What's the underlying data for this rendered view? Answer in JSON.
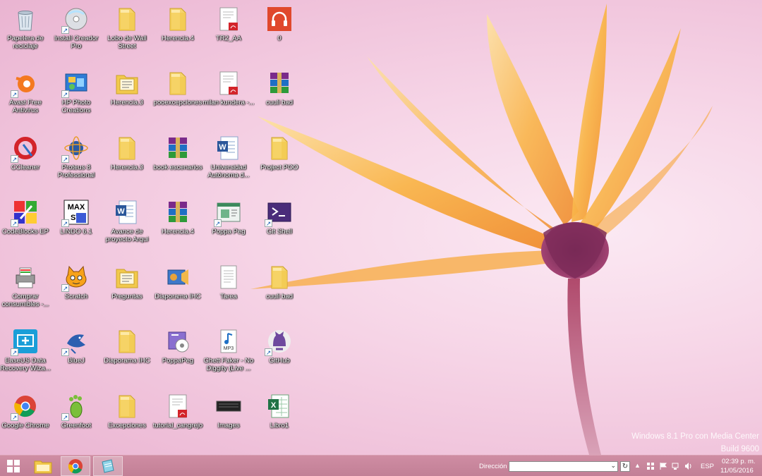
{
  "desktop": {
    "icons": [
      {
        "label": "Papelera de reciclaje",
        "icon": "recycle-bin-icon",
        "shortcut": false
      },
      {
        "label": "Avast Free Antivirus",
        "icon": "avast-icon",
        "shortcut": true
      },
      {
        "label": "CCleaner",
        "icon": "ccleaner-icon",
        "shortcut": true
      },
      {
        "label": "CodeBlocks EP",
        "icon": "codeblocks-icon",
        "shortcut": true
      },
      {
        "label": "Comprar consumibles -...",
        "icon": "printer-icon",
        "shortcut": false
      },
      {
        "label": "EaseUS Data Recovery Wiza...",
        "icon": "easeus-icon",
        "shortcut": true
      },
      {
        "label": "Google Chrome",
        "icon": "chrome-icon",
        "shortcut": true
      },
      {
        "label": "Instalí Creador Pro",
        "icon": "disc-icon",
        "shortcut": true
      },
      {
        "label": "HP Photo Creations",
        "icon": "hp-photo-icon",
        "shortcut": true
      },
      {
        "label": "Proteus 8 Professional",
        "icon": "proteus-icon",
        "shortcut": true
      },
      {
        "label": "LINDO 6.1",
        "icon": "lindo-icon",
        "shortcut": true
      },
      {
        "label": "Scratch",
        "icon": "scratch-icon",
        "shortcut": true
      },
      {
        "label": "BlueJ",
        "icon": "bluej-icon",
        "shortcut": true
      },
      {
        "label": "Greenfoot",
        "icon": "greenfoot-icon",
        "shortcut": true
      },
      {
        "label": "Lobo de Wall Street",
        "icon": "folder-icon",
        "shortcut": false
      },
      {
        "label": "Herencia.3",
        "icon": "folder-doc-icon",
        "shortcut": false
      },
      {
        "label": "Herencia.3",
        "icon": "folder-icon",
        "shortcut": false
      },
      {
        "label": "Avance de proyecto Arqui",
        "icon": "word-icon",
        "shortcut": false
      },
      {
        "label": "Preguntas",
        "icon": "folder-doc-icon",
        "shortcut": false
      },
      {
        "label": "Diaporama IHC",
        "icon": "folder-icon",
        "shortcut": false
      },
      {
        "label": "Excepciones",
        "icon": "folder-icon",
        "shortcut": false
      },
      {
        "label": "Herencia.4",
        "icon": "folder-icon",
        "shortcut": false
      },
      {
        "label": "pooexcepciones",
        "icon": "folder-icon",
        "shortcut": false
      },
      {
        "label": "book escenarios",
        "icon": "winrar-icon",
        "shortcut": false
      },
      {
        "label": "Herencia.4",
        "icon": "winrar-icon",
        "shortcut": false
      },
      {
        "label": "Diaporama IHC",
        "icon": "movie-maker-icon",
        "shortcut": false
      },
      {
        "label": "PoppaPeg",
        "icon": "installer-icon",
        "shortcut": false
      },
      {
        "label": "tutorial_cangrejo",
        "icon": "pdf-icon",
        "shortcut": false
      },
      {
        "label": "TR2_AA",
        "icon": "pdf-icon",
        "shortcut": false
      },
      {
        "label": "milan kundera -...",
        "icon": "pdf-icon",
        "shortcut": false
      },
      {
        "label": "Universidad Autónoma d...",
        "icon": "word-icon",
        "shortcut": false
      },
      {
        "label": "Poppa Peg",
        "icon": "app-window-icon",
        "shortcut": true
      },
      {
        "label": "Tarea",
        "icon": "text-file-icon",
        "shortcut": false
      },
      {
        "label": "Ghett Faker - No Diggity (Live ...",
        "icon": "mp3-icon",
        "shortcut": false
      },
      {
        "label": "Images",
        "icon": "keyboard-image-icon",
        "shortcut": false
      },
      {
        "label": "0",
        "icon": "headphones-icon",
        "shortcut": false
      },
      {
        "label": "cuuli bad",
        "icon": "winrar-icon",
        "shortcut": false
      },
      {
        "label": "Project POO",
        "icon": "folder-icon",
        "shortcut": false
      },
      {
        "label": "Git Shell",
        "icon": "powershell-icon",
        "shortcut": true
      },
      {
        "label": "cuuli bad",
        "icon": "folder-icon",
        "shortcut": false
      },
      {
        "label": "GitHub",
        "icon": "github-icon",
        "shortcut": true
      },
      {
        "label": "Libro1",
        "icon": "excel-icon",
        "shortcut": false
      }
    ]
  },
  "watermark": {
    "line1": "Windows 8.1 Pro con Media Center",
    "line2": "Build 9600"
  },
  "taskbar": {
    "start_icon": "windows-start-icon",
    "pinned": [
      {
        "name": "file-explorer",
        "icon": "folder-icon",
        "active": false
      },
      {
        "name": "chrome",
        "icon": "chrome-icon",
        "active": true
      },
      {
        "name": "note-app",
        "icon": "notebook-icon",
        "active": true
      }
    ],
    "address_label": "Dirección",
    "address_value": "",
    "language": "ESP",
    "time": "02:39 p. m.",
    "date": "11/05/2016"
  },
  "colors": {
    "taskbar": "#c8879d",
    "folder": "#f2c94c",
    "accent": "#1a5fb4"
  }
}
